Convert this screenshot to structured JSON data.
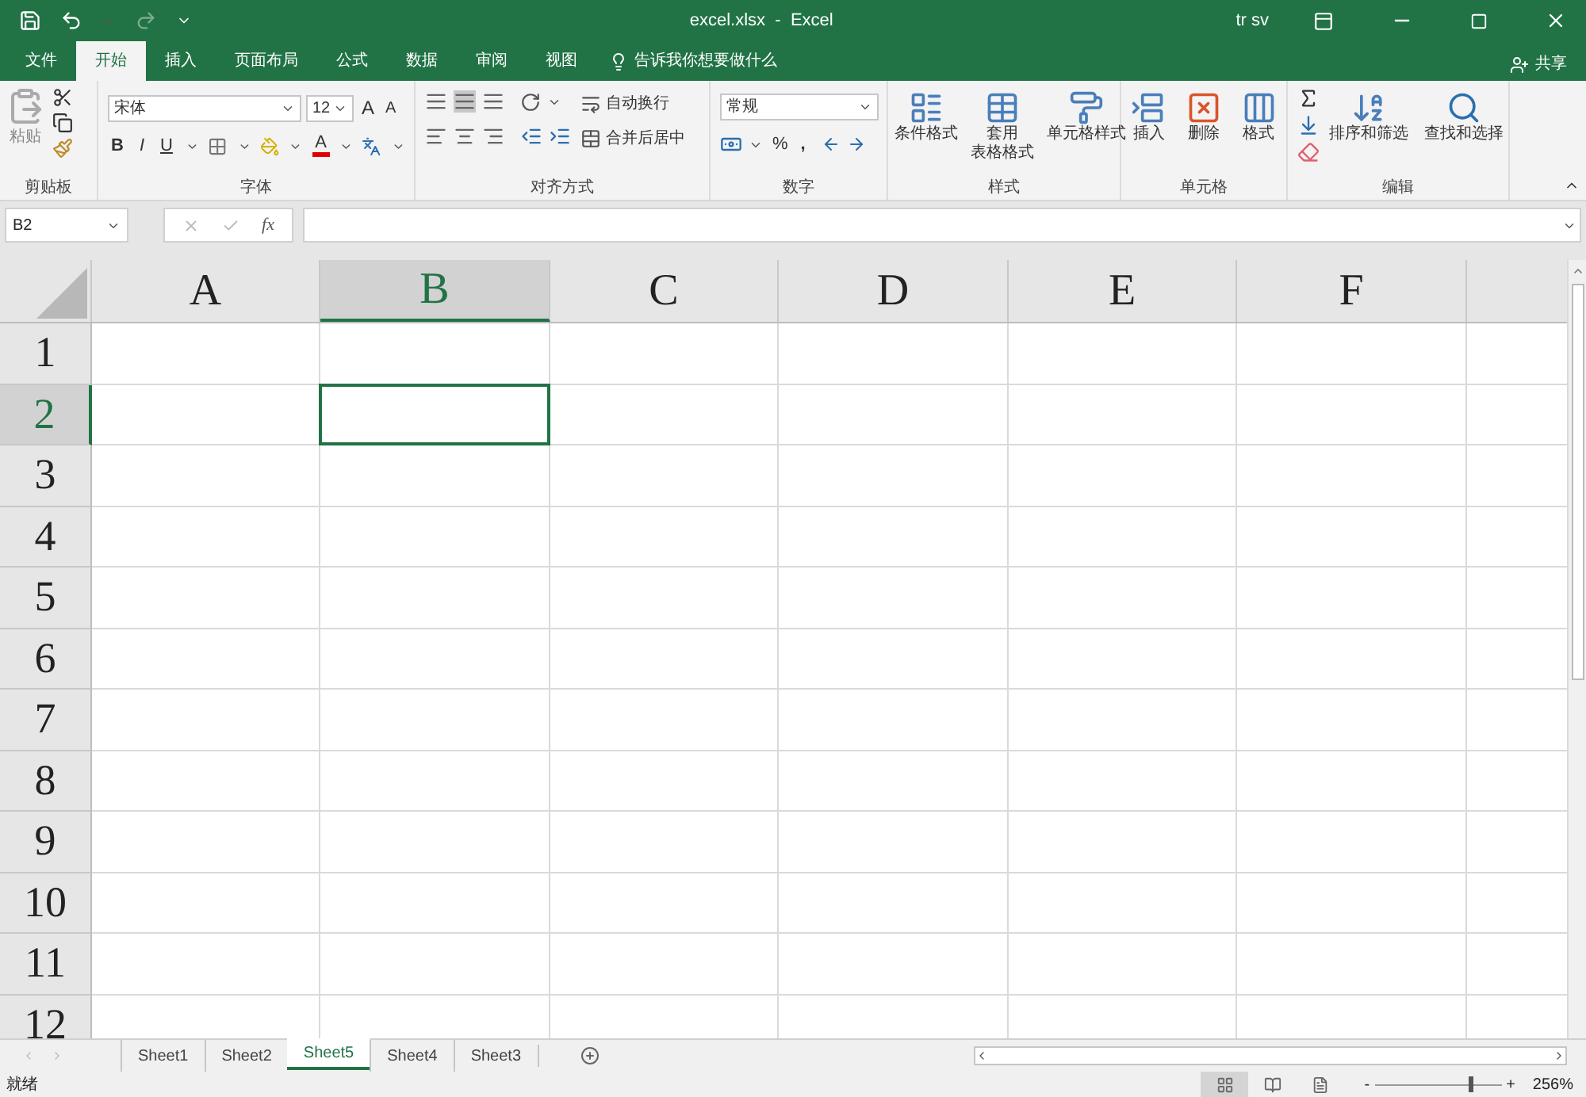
{
  "title_bar": {
    "title": "excel.xlsx  -  Excel",
    "user": "tr sv"
  },
  "menu_tabs": [
    {
      "label": "文件",
      "selected": false
    },
    {
      "label": "开始",
      "selected": true
    },
    {
      "label": "插入",
      "selected": false
    },
    {
      "label": "页面布局",
      "selected": false
    },
    {
      "label": "公式",
      "selected": false
    },
    {
      "label": "数据",
      "selected": false
    },
    {
      "label": "审阅",
      "selected": false
    },
    {
      "label": "视图",
      "selected": false
    }
  ],
  "tell_me": "告诉我你想要做什么",
  "share": "共享",
  "ribbon": {
    "clipboard": {
      "paste": "粘贴",
      "label": "剪贴板"
    },
    "font": {
      "font_name": "宋体",
      "font_size": "12",
      "grow": "A",
      "shrink": "A",
      "bold": "B",
      "italic": "I",
      "underline": "U",
      "font_color": "A",
      "label": "字体"
    },
    "alignment": {
      "wrap_text": "自动换行",
      "merge": "合并后居中",
      "label": "对齐方式"
    },
    "number": {
      "format": "常规",
      "percent": "%",
      "comma": ",",
      "label": "数字"
    },
    "styles": {
      "buttons": [
        {
          "lines": [
            "条件格式"
          ]
        },
        {
          "lines": [
            "套用",
            "表格格式"
          ]
        },
        {
          "lines": [
            "单元格样式"
          ]
        }
      ],
      "label": "样式"
    },
    "cells": {
      "buttons": [
        "插入",
        "删除",
        "格式"
      ],
      "label": "单元格"
    },
    "editing": {
      "buttons": [
        "排序和筛选",
        "查找和选择"
      ],
      "label": "编辑"
    }
  },
  "formula_bar": {
    "name_box": "B2",
    "fx": "fx"
  },
  "grid": {
    "columns": [
      {
        "label": "A",
        "selected": false
      },
      {
        "label": "B",
        "selected": true
      },
      {
        "label": "C",
        "selected": false
      },
      {
        "label": "D",
        "selected": false
      },
      {
        "label": "E",
        "selected": false
      },
      {
        "label": "F",
        "selected": false
      }
    ],
    "rows": [
      {
        "label": "1",
        "selected": false
      },
      {
        "label": "2",
        "selected": true
      },
      {
        "label": "3",
        "selected": false
      },
      {
        "label": "4",
        "selected": false
      },
      {
        "label": "5",
        "selected": false
      },
      {
        "label": "6",
        "selected": false
      },
      {
        "label": "7",
        "selected": false
      },
      {
        "label": "8",
        "selected": false
      },
      {
        "label": "9",
        "selected": false
      },
      {
        "label": "10",
        "selected": false
      },
      {
        "label": "11",
        "selected": false
      },
      {
        "label": "12",
        "selected": false
      }
    ]
  },
  "sheet_tabs": [
    {
      "label": "Sheet1",
      "selected": false
    },
    {
      "label": "Sheet2",
      "selected": false
    },
    {
      "label": "Sheet5",
      "selected": true
    },
    {
      "label": "Sheet4",
      "selected": false
    },
    {
      "label": "Sheet3",
      "selected": false
    }
  ],
  "status_bar": {
    "status": "就绪",
    "views": [
      {
        "selected": true
      },
      {
        "selected": false
      },
      {
        "selected": false
      }
    ],
    "zoom_out": "-",
    "zoom_in": "+",
    "zoom": {
      "level": 0.75
    },
    "zoom_text": "256%"
  }
}
